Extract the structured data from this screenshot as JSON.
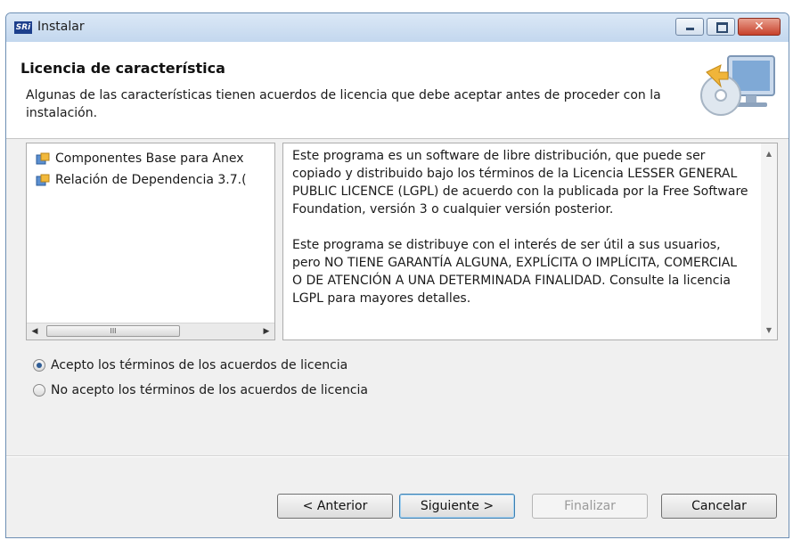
{
  "window": {
    "app_icon_text": "SRi",
    "title": "Instalar",
    "close_glyph": "✕"
  },
  "header": {
    "title": "Licencia de característica",
    "description": "Algunas de las características tienen acuerdos de licencia que debe aceptar antes de proceder con la instalación."
  },
  "features": {
    "items": [
      {
        "label": "Componentes Base para Anex",
        "icon": "feature-package-icon"
      },
      {
        "label": "Relación de Dependencia 3.7.(",
        "icon": "feature-package-icon"
      }
    ],
    "scroll_left_glyph": "◀",
    "scroll_right_glyph": "▶",
    "scroll_thumb_grip": "III"
  },
  "license": {
    "paragraph1": "Este programa es un software de libre distribución, que puede ser copiado y distribuido bajo los términos de la Licencia LESSER GENERAL PUBLIC LICENCE (LGPL) de acuerdo con la publicada por la Free Software Foundation, versión 3 o cualquier versión posterior.",
    "paragraph2": "Este programa se distribuye con el interés de ser útil a sus usuarios, pero NO TIENE GARANTÍA ALGUNA, EXPLÍCITA O IMPLÍCITA, COMERCIAL O DE ATENCIÓN A UNA DETERMINADA FINALIDAD. Consulte la licencia LGPL para mayores detalles.",
    "scroll_up_glyph": "▲",
    "scroll_down_glyph": "▼"
  },
  "options": {
    "accept": "Acepto los términos de los acuerdos de licencia",
    "decline": "No acepto los términos de los acuerdos de licencia",
    "selected": "accept"
  },
  "buttons": {
    "back": "< Anterior",
    "next": "Siguiente >",
    "finish": "Finalizar",
    "cancel": "Cancelar"
  },
  "colors": {
    "accent": "#3c7fb1",
    "close_button": "#c7412b"
  }
}
